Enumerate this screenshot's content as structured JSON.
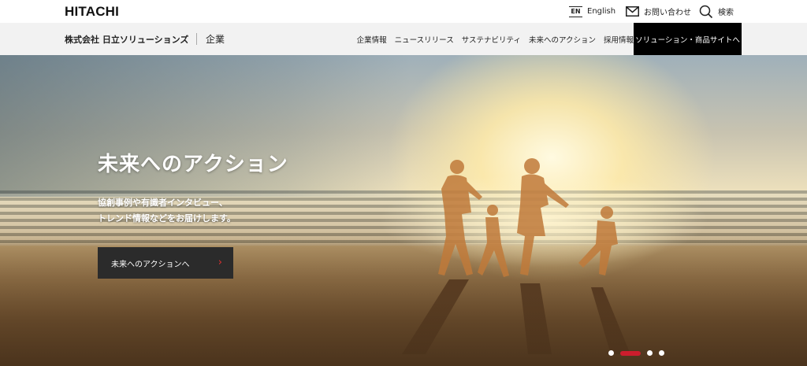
{
  "header": {
    "logo": "HITACHI",
    "utility": {
      "language_code": "EN",
      "language_label": "English",
      "contact_label": "お問い合わせ",
      "search_label": "検索"
    }
  },
  "nav": {
    "company_name": "株式会社 日立ソリューションズ",
    "section_label": "企業",
    "links": [
      "企業情報",
      "ニュースリリース",
      "サステナビリティ",
      "未来へのアクション",
      "採用情報"
    ],
    "solutions_button": "ソリューション・商品サイトへ"
  },
  "hero": {
    "title": "未来へのアクション",
    "subtitle_line1": "協創事例や有識者インタビュー、",
    "subtitle_line2": "トレンド情報などをお届けします。",
    "cta_label": "未来へのアクションへ",
    "cta_arrow": "›",
    "carousel": {
      "count": 4,
      "active_index": 1
    }
  },
  "colors": {
    "accent": "#cc1d2d",
    "nav_bg": "#f2f2f2",
    "button_bg": "#000000"
  }
}
